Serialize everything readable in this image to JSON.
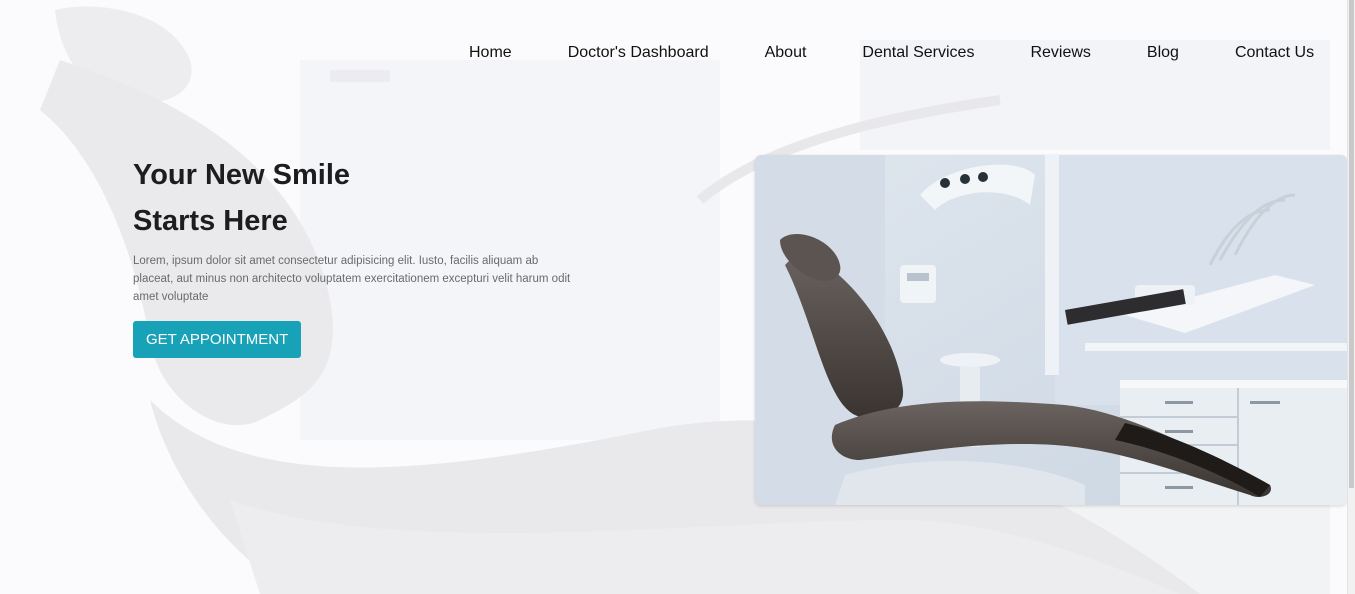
{
  "nav": {
    "items": [
      {
        "label": "Home"
      },
      {
        "label": "Doctor's Dashboard"
      },
      {
        "label": "About"
      },
      {
        "label": "Dental Services"
      },
      {
        "label": "Reviews"
      },
      {
        "label": "Blog"
      },
      {
        "label": "Contact Us"
      }
    ]
  },
  "hero": {
    "title_line1": "Your New Smile",
    "title_line2": "Starts Here",
    "description": "Lorem, ipsum dolor sit amet consectetur adipisicing elit. Iusto, facilis aliquam ab placeat, aut minus non architecto voluptatem exercitationem excepturi velit harum odit amet voluptate",
    "cta_label": "GET APPOINTMENT"
  },
  "colors": {
    "accent": "#17a2b8",
    "text_dark": "#1d1d1f",
    "text_muted": "#6a6a6a"
  },
  "icons": {
    "hero_image": "dental-chair-photo"
  }
}
